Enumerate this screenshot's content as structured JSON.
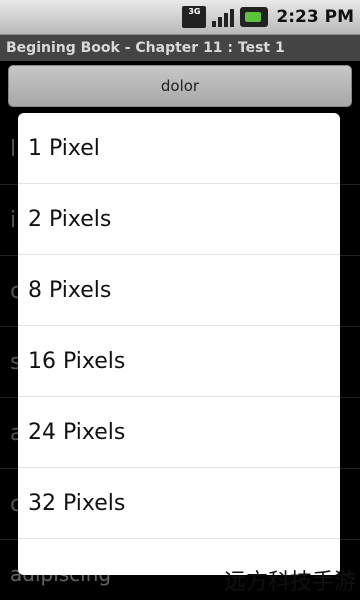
{
  "status_bar": {
    "network": "3G",
    "time": "2:23 PM"
  },
  "title_bar": {
    "title": "Begining Book - Chapter 11 : Test 1"
  },
  "spinner": {
    "selected": "dolor"
  },
  "background_list": {
    "items": [
      "l",
      "i",
      "c",
      "s",
      "a",
      "c"
    ],
    "last_visible": "adipiscing"
  },
  "dialog": {
    "options": [
      "1 Pixel",
      "2 Pixels",
      "8 Pixels",
      "16 Pixels",
      "24 Pixels",
      "32 Pixels",
      ""
    ]
  },
  "watermark": "远方科技手游"
}
